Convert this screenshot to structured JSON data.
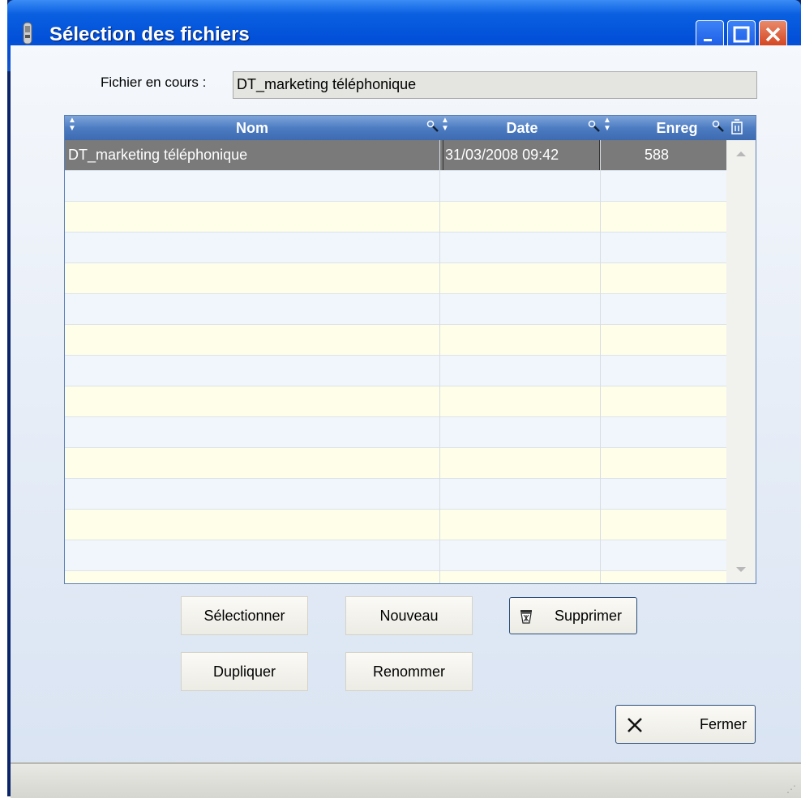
{
  "window": {
    "title": "Sélection des fichiers"
  },
  "current_file": {
    "label": "Fichier en cours :",
    "value": "DT_marketing téléphonique"
  },
  "table": {
    "columns": [
      "Nom",
      "Date",
      "Enreg"
    ],
    "rows": [
      {
        "nom": "DT_marketing téléphonique",
        "date": "31/03/2008  09:42",
        "enreg": "588"
      }
    ]
  },
  "buttons": {
    "selectionner": "Sélectionner",
    "nouveau": "Nouveau",
    "supprimer": "Supprimer",
    "dupliquer": "Dupliquer",
    "renommer": "Renommer",
    "fermer": "Fermer"
  },
  "colors": {
    "titlebar": "#0250d8",
    "header": "#4d7cc2",
    "selected_row": "#7a7a7a",
    "row_even": "#fffee8",
    "row_odd": "#f0f6fc"
  }
}
